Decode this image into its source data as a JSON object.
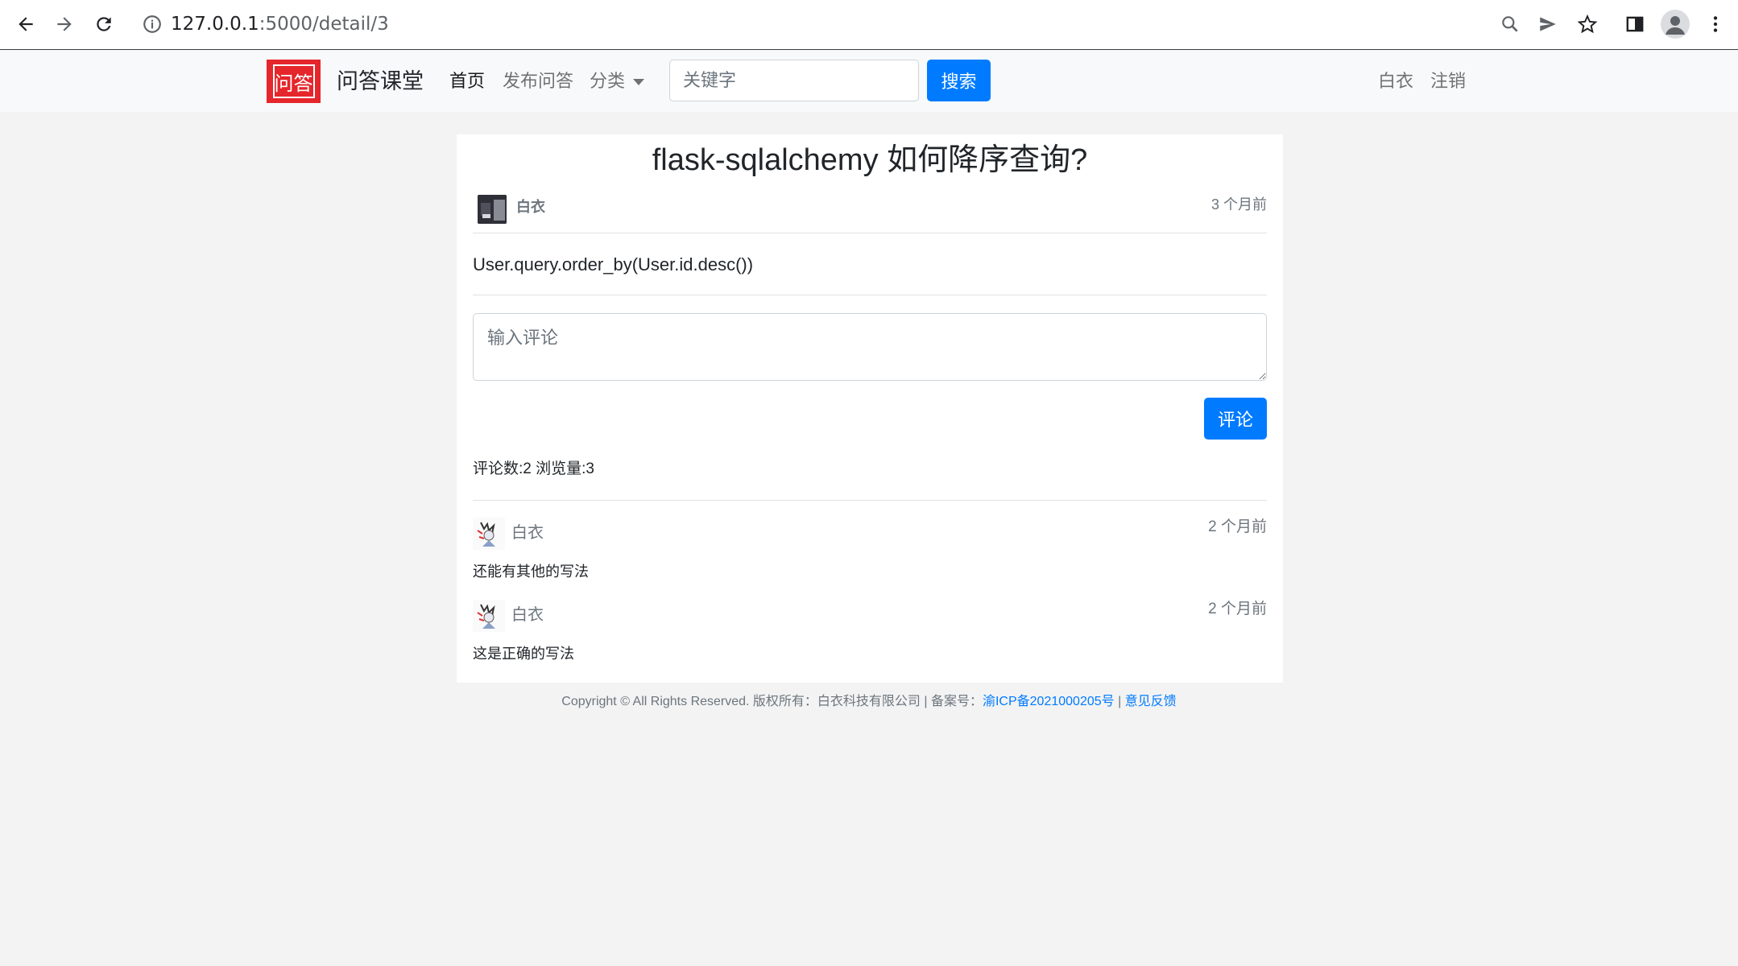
{
  "browser": {
    "url_host": "127.0.0.1",
    "url_rest": ":5000/detail/3"
  },
  "navbar": {
    "logo_text": "问答",
    "brand": "问答课堂",
    "links": [
      {
        "label": "首页"
      },
      {
        "label": "发布问答"
      },
      {
        "label": "分类"
      }
    ],
    "search_placeholder": "关键字",
    "search_button": "搜索",
    "user": "白衣",
    "logout": "注销"
  },
  "question": {
    "title": "flask-sqlalchemy 如何降序查询?",
    "author": "白衣",
    "time": "3 个月前",
    "content": "User.query.order_by(User.id.desc())"
  },
  "comment_form": {
    "placeholder": "输入评论",
    "button": "评论"
  },
  "stats": "评论数:2 浏览量:3",
  "comments": [
    {
      "author": "白衣",
      "time": "2 个月前",
      "text": "还能有其他的写法"
    },
    {
      "author": "白衣",
      "time": "2 个月前",
      "text": "这是正确的写法"
    }
  ],
  "footer": {
    "copyright": "Copyright © All Rights Reserved. 版权所有：白衣科技有限公司 | 备案号：",
    "icp": "渝ICP备2021000205号",
    "sep": " | ",
    "feedback": "意见反馈"
  },
  "colors": {
    "primary": "#007bff",
    "logo": "#e5262b",
    "page_bg": "#f3f3f3"
  }
}
